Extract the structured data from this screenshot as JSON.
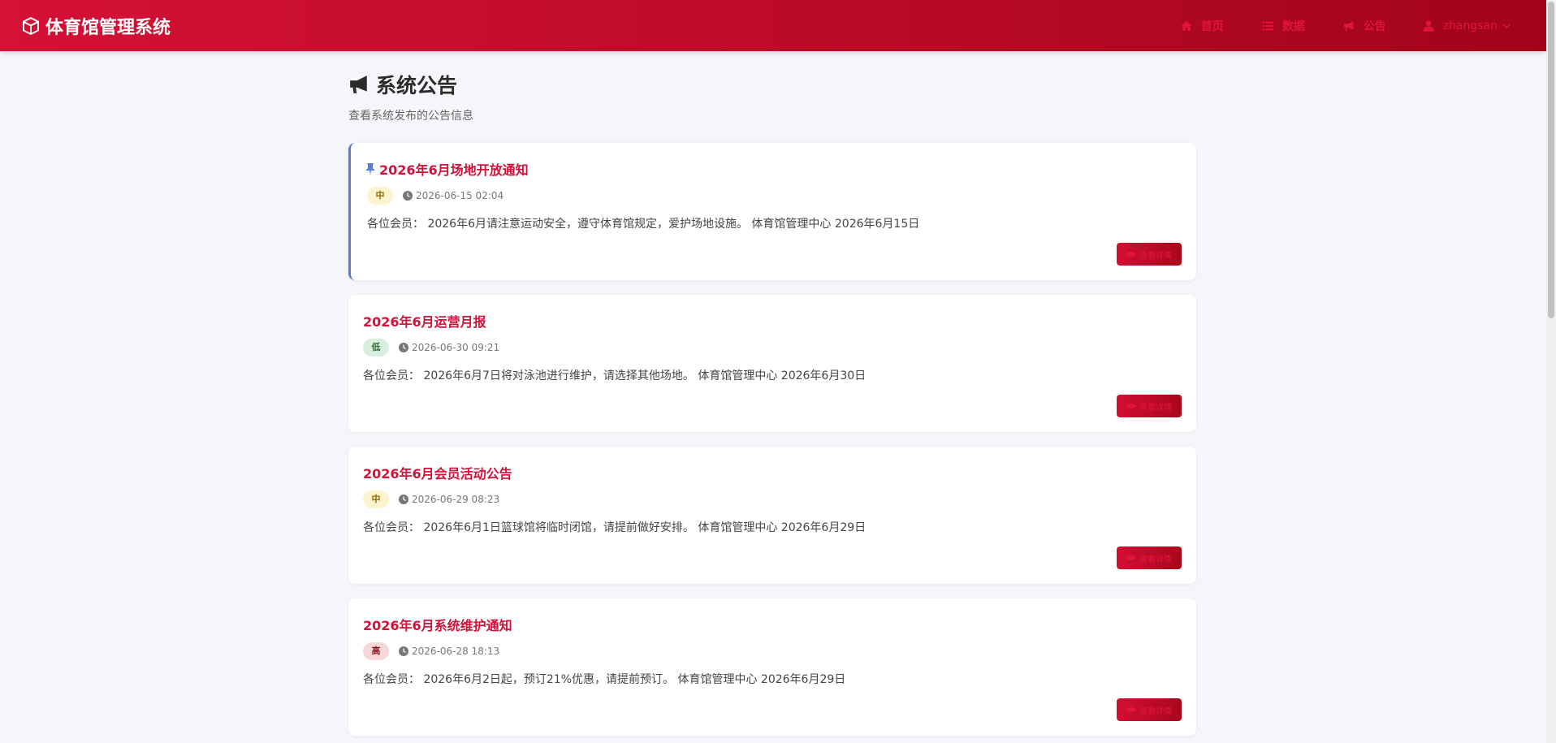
{
  "nav": {
    "brand": "体育馆管理系统",
    "items": [
      {
        "label": "首页",
        "icon": "home-icon"
      },
      {
        "label": "数据",
        "icon": "list-icon"
      },
      {
        "label": "公告",
        "icon": "megaphone-icon"
      }
    ],
    "user": "zhangsan"
  },
  "page": {
    "title": "系统公告",
    "subtitle": "查看系统发布的公告信息"
  },
  "detail_label": "查看详情",
  "notices": [
    {
      "title": "2026年6月场地开放通知",
      "priority": "中",
      "time": "2026-06-15 02:04",
      "content": "各位会员： 2026年6月请注意运动安全，遵守体育馆规定，爱护场地设施。 体育馆管理中心 2026年6月15日",
      "pinned": true
    },
    {
      "title": "2026年6月运营月报",
      "priority": "低",
      "time": "2026-06-30 09:21",
      "content": "各位会员： 2026年6月7日将对泳池进行维护，请选择其他场地。 体育馆管理中心 2026年6月30日",
      "pinned": false
    },
    {
      "title": "2026年6月会员活动公告",
      "priority": "中",
      "time": "2026-06-29 08:23",
      "content": "各位会员： 2026年6月1日篮球馆将临时闭馆，请提前做好安排。 体育馆管理中心 2026年6月29日",
      "pinned": false
    },
    {
      "title": "2026年6月系统维护通知",
      "priority": "高",
      "time": "2026-06-28 18:13",
      "content": "各位会员： 2026年6月2日起，预订21%优惠，请提前预订。 体育馆管理中心 2026年6月29日",
      "pinned": false
    }
  ],
  "colors": {
    "accent": "#d21239",
    "priority_mid_bg": "#fdf3cf",
    "priority_mid_fg": "#8a6a00",
    "priority_low_bg": "#d7efdc",
    "priority_low_fg": "#2e6b3a",
    "priority_high_bg": "#f8d7da",
    "priority_high_fg": "#8b1e2b"
  }
}
